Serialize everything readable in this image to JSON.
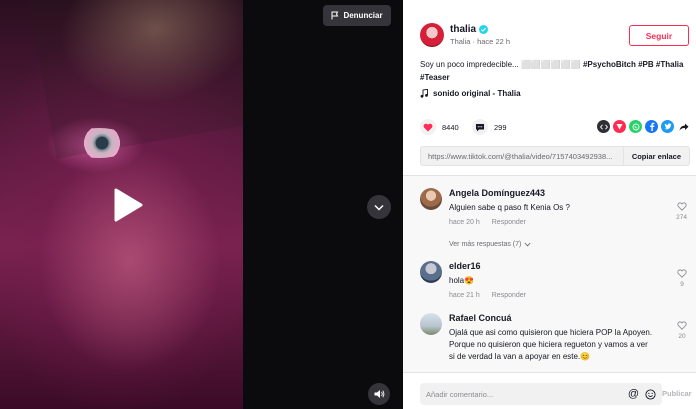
{
  "video": {
    "report_label": "Denunciar",
    "report_icon": "flag-icon",
    "play_icon": "play-icon",
    "next_icon": "chevron-down-icon",
    "volume_icon": "volume-icon"
  },
  "author": {
    "name": "thalia",
    "verified_icon": "verified-badge-icon",
    "subtitle": "Thalia · hace 22 h",
    "follow_label": "Seguir"
  },
  "caption": {
    "text": "Soy un poco impredecible... ⬜⬜⬜⬜⬜⬜",
    "tags": [
      "#PsychoBitch",
      "#PB",
      "#Thalia",
      "#Teaser"
    ]
  },
  "sound": {
    "icon": "music-note-icon",
    "label": "sonido original - Thalia"
  },
  "stats": {
    "likes": "8440",
    "comments": "299"
  },
  "share_icons": [
    {
      "name": "embed-icon",
      "color": "#2f2f33",
      "glyph": "</>"
    },
    {
      "name": "send-icon",
      "color": "#fe2c55",
      "glyph": "▼"
    },
    {
      "name": "whatsapp-icon",
      "color": "#25d366",
      "glyph": "✆"
    },
    {
      "name": "facebook-icon",
      "color": "#1877f2",
      "glyph": "f"
    },
    {
      "name": "twitter-icon",
      "color": "#1d9bf0",
      "glyph": "✶"
    },
    {
      "name": "share-arrow-icon",
      "color": "#ffffff",
      "glyph": "➦"
    }
  ],
  "link": {
    "url": "https://www.tiktok.com/@thalia/video/7157403492938...",
    "copy_label": "Copiar enlace"
  },
  "comments": [
    {
      "name": "Angela Domínguez443",
      "text": "Alguien sabe q paso ft Kenia Os ?",
      "time": "hace 20 h",
      "reply_label": "Responder",
      "likes": "274",
      "more_replies": "Ver más respuestas (7)"
    },
    {
      "name": "elder16",
      "text": "hola😍",
      "time": "hace 21 h",
      "reply_label": "Responder",
      "likes": "9"
    },
    {
      "name": "Rafael Concuá",
      "text": "Ojalá que asi como quisieron que hiciera POP la Apoyen. Porque no quisieron que hiciera regueton y vamos a ver si de verdad la van a apoyar en este.😊",
      "likes": "20"
    }
  ],
  "comment_bar": {
    "placeholder": "Añadir comentario...",
    "post_label": "Publicar"
  },
  "colors": {
    "accent": "#fe2c55",
    "verified": "#20d5ec"
  }
}
